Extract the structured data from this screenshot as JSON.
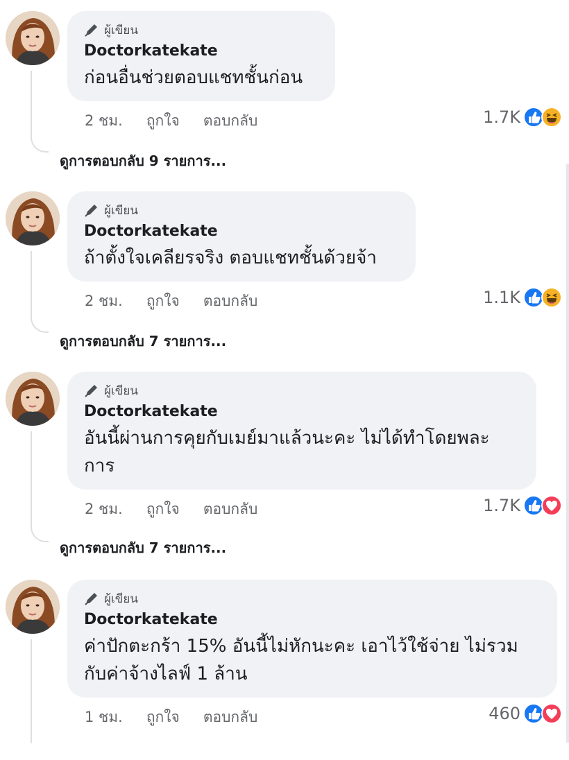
{
  "author_badge": "ผู้เขียน",
  "comments": [
    {
      "author": "Doctorkatekate",
      "text": "ก่อนอื่นช่วยตอบแชทชั้นก่อน",
      "time": "2 ชม.",
      "like": "ถูกใจ",
      "reply": "ตอบกลับ",
      "reaction_count": "1.7K",
      "reactions": [
        "like-icon",
        "haha-icon"
      ],
      "view_replies": "ดูการตอบกลับ 9 รายการ..."
    },
    {
      "author": "Doctorkatekate",
      "text": "ถ้าตั้งใจเคลียรจริง ตอบแชทชั้นด้วยจ้า",
      "time": "2 ชม.",
      "like": "ถูกใจ",
      "reply": "ตอบกลับ",
      "reaction_count": "1.1K",
      "reactions": [
        "like-icon",
        "haha-icon"
      ],
      "view_replies": "ดูการตอบกลับ 7 รายการ..."
    },
    {
      "author": "Doctorkatekate",
      "text_lines": [
        "อันนี้ผ่านการคุยกับเมย์มาแล้วนะคะ ไม่ได้ทำโดยพละ",
        "การ"
      ],
      "time": "2 ชม.",
      "like": "ถูกใจ",
      "reply": "ตอบกลับ",
      "reaction_count": "1.7K",
      "reactions": [
        "like-icon",
        "love-icon"
      ],
      "view_replies": "ดูการตอบกลับ 7 รายการ..."
    },
    {
      "author": "Doctorkatekate",
      "text_lines": [
        "ค่าปักตะกร้า 15% อันนี้ไม่หักนะคะ เอาไว้ใช้จ่าย ไม่รวม",
        "กับค่าจ้างไลฟ์ 1 ล้าน"
      ],
      "time": "1 ชม.",
      "like": "ถูกใจ",
      "reply": "ตอบกลับ",
      "reaction_count": "460",
      "reactions": [
        "like-icon",
        "love-icon"
      ]
    }
  ],
  "colors": {
    "bubble": "#f0f2f5",
    "like_blue": "#1877f2",
    "haha_yellow": "#f7b125",
    "love_red": "#f33e58",
    "meta_gray": "#65676b"
  }
}
